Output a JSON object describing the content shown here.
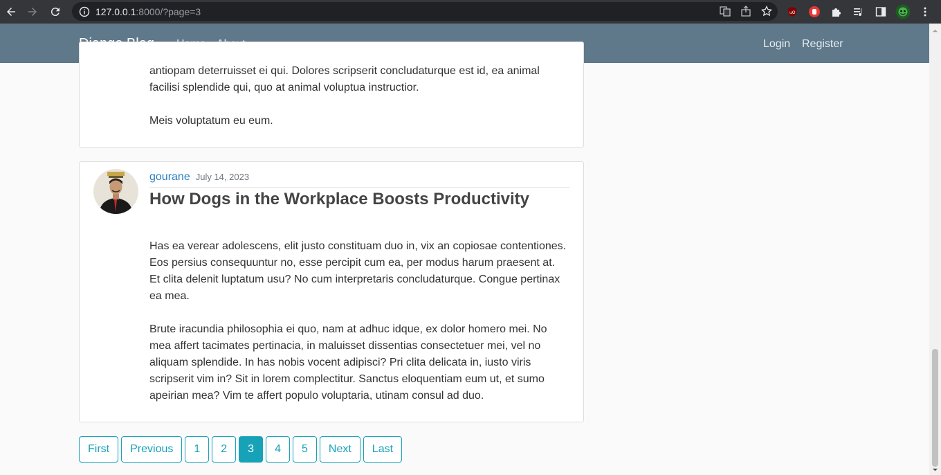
{
  "browser": {
    "url_host": "127.0.0.1",
    "url_rest": ":8000/?page=3",
    "icons": [
      "back-icon",
      "forward-icon",
      "reload-icon",
      "info-icon",
      "translate-icon",
      "share-icon",
      "bookmark-star-icon",
      "ublock-icon",
      "extension-red-icon",
      "puzzle-icon",
      "reading-list-icon",
      "side-panel-icon",
      "profile-avatar-icon",
      "kebab-menu-icon"
    ]
  },
  "navbar": {
    "brand": "Django Blog",
    "links": [
      "Home",
      "About"
    ],
    "auth_links": [
      "Login",
      "Register"
    ]
  },
  "posts": [
    {
      "partial": true,
      "paragraphs": [
        "antiopam deterruisset ei qui. Dolores scripserit concludaturque est id, ea animal facilisi splendide qui, quo at animal voluptua instructior.",
        "Meis voluptatum eu eum."
      ]
    },
    {
      "author": "gourane",
      "date": "July 14, 2023",
      "title": "How Dogs in the Workplace Boosts Productivity",
      "paragraphs": [
        "Has ea verear adolescens, elit justo constituam duo in, vix an copiosae contentiones. Eos persius consequuntur no, esse percipit cum ea, per modus harum praesent at. Et clita delenit luptatum usu? No cum interpretaris concludaturque. Congue pertinax ea mea.",
        "Brute iracundia philosophia ei quo, nam at adhuc idque, ex dolor homero mei. No mea affert tacimates pertinacia, in maluisset dissentias consectetuer mei, vel no aliquam splendide. In has nobis vocent adipisci? Pri clita delicata in, iusto viris scripserit vim in? Sit in lorem complectitur. Sanctus eloquentiam eum ut, et sumo apeirian mea? Vim te affert populo voluptaria, utinam consul ad duo."
      ]
    }
  ],
  "pagination": {
    "first": "First",
    "previous": "Previous",
    "pages": [
      "1",
      "2",
      "3",
      "4",
      "5"
    ],
    "current": "3",
    "next": "Next",
    "last": "Last"
  },
  "colors": {
    "navbar": "#5f788a",
    "accent": "#17a2b8",
    "link": "#2a7fc1"
  }
}
